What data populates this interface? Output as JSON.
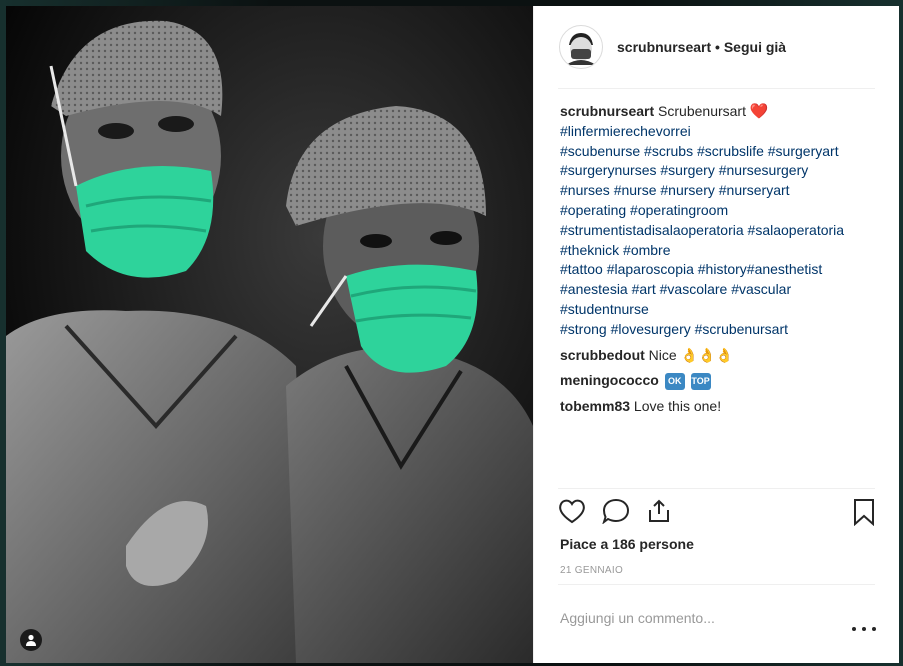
{
  "post": {
    "username": "scrubnurseart",
    "follow_status": "• Segui già",
    "caption": {
      "user": "scrubnurseart",
      "text": "Scrubenursart",
      "emoji": "❤️",
      "hashtag_lines": [
        "#linfermierechevorrei",
        "#scubenurse #scrubs #scrubslife #surgeryart",
        "#surgerynurses #surgery #nursesurgery",
        "#nurses #nurse #nursery #nurseryart",
        "#operating #operatingroom",
        "#strumentistadisalaoperatoria #salaoperatoria",
        "#theknick #ombre",
        "#tattoo #laparoscopia #history#anesthetist",
        "#anestesia #art #vascolare #vascular",
        "#studentnurse",
        "#strong #lovesurgery #scrubenursart"
      ]
    },
    "comments": [
      {
        "user": "scrubbedout",
        "text": "Nice",
        "emoji": "👌👌👌"
      },
      {
        "user": "meningococco",
        "text": "",
        "badges": [
          "OK",
          "TOP"
        ]
      },
      {
        "user": "tobemm83",
        "text": "Love this one!"
      }
    ],
    "likes": "Piace a 186 persone",
    "date": "21 GENNAIO",
    "comment_placeholder": "Aggiungi un commento...",
    "icons": {
      "like": "heart-outline-icon",
      "comment": "speech-bubble-icon",
      "share": "share-icon",
      "save": "bookmark-icon",
      "more": "more-options-icon",
      "user_tag": "person-icon"
    },
    "colors": {
      "text": "#262626",
      "hashtag": "#003569",
      "muted": "#999999",
      "mask_green": "#2ed39b",
      "heart": "#e0202b",
      "badge": "#3b88c3"
    }
  }
}
